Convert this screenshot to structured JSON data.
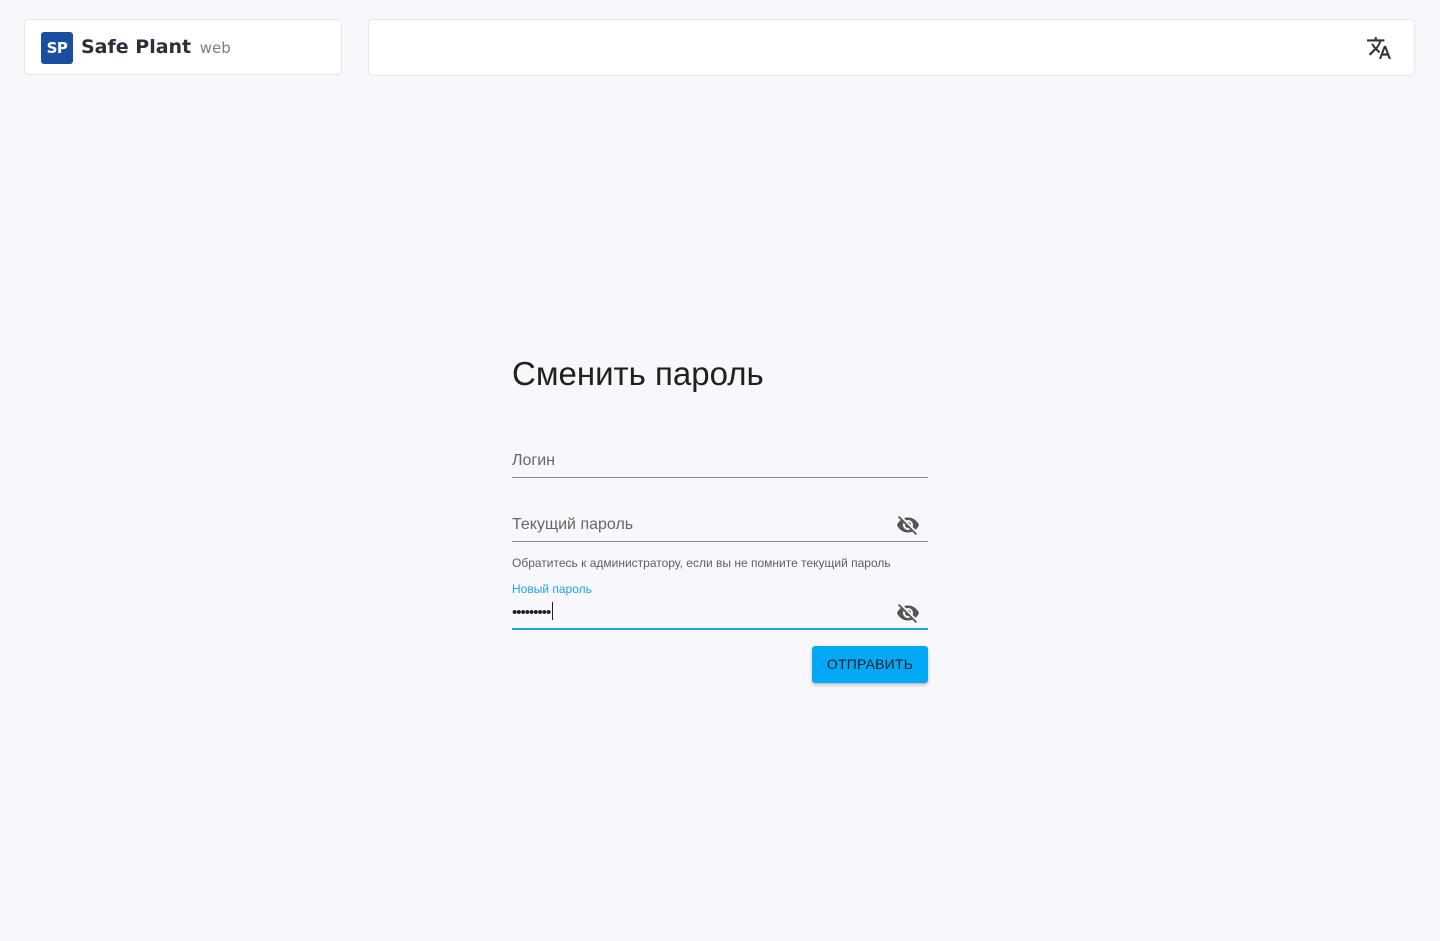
{
  "header": {
    "logo_mark": "SP",
    "app_name": "Safe Plant",
    "app_suffix": "web",
    "language_icon": "translate-icon"
  },
  "form": {
    "title": "Сменить пароль",
    "login": {
      "placeholder": "Логин",
      "value": ""
    },
    "current_password": {
      "placeholder": "Текущий пароль",
      "value": "",
      "visibility_icon": "eye-off-icon",
      "helper_text": "Обратитесь к администратору, если вы не помните текущий пароль"
    },
    "new_password": {
      "label": "Новый пароль",
      "value": "•••••••••",
      "visibility_icon": "eye-off-icon"
    },
    "submit_label": "ОТПРАВИТЬ"
  },
  "colors": {
    "accent": "#1ea4e9",
    "button": "#03a9f4",
    "logo_bg": "#1a4fa0",
    "background": "#f8f8fc"
  }
}
